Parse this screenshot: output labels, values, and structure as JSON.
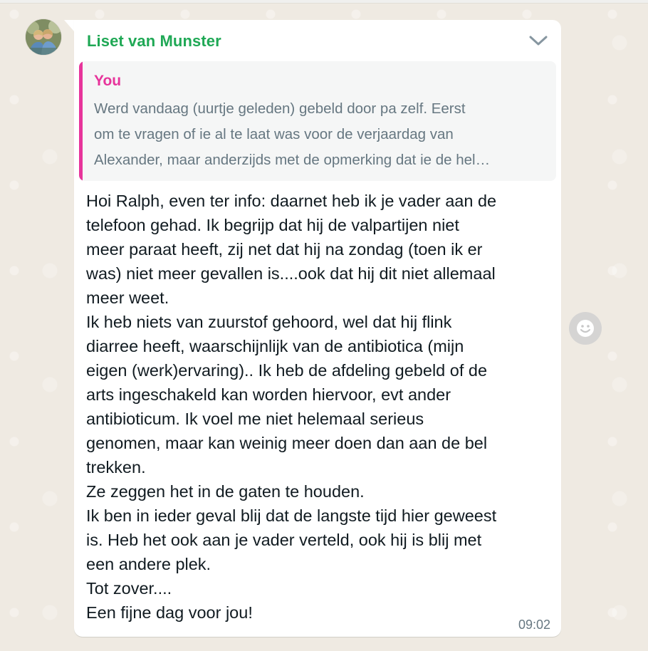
{
  "conversation": {
    "sender_name": "Liset van Munster",
    "avatar_icon": "profile-photo",
    "message_menu_icon": "chevron-down-icon",
    "quoted_message": {
      "author": "You",
      "text": "Werd vandaag (uurtje geleden) gebeld door pa zelf. Eerst\nom te vragen of ie al te laat was voor de verjaardag van\nAlexander, maar anderzijds met de opmerking dat ie de hel…"
    },
    "message_text": "Hoi Ralph, even ter info: daarnet heb ik je vader aan de\ntelefoon gehad. Ik begrijp dat hij de valpartijen niet\nmeer paraat heeft, zij net dat hij na zondag (toen ik er\nwas) niet meer gevallen is....ook dat hij dit niet allemaal\nmeer weet.\nIk heb niets van zuurstof gehoord, wel dat hij flink\ndiarree heeft, waarschijnlijk van de antibiotica (mijn\neigen (werk)ervaring).. Ik heb de afdeling gebeld of de\narts ingeschakeld kan worden hiervoor, evt ander\nantibioticum. Ik voel me niet helemaal serieus\ngenomen, maar kan weinig meer doen dan aan de bel\ntrekken.\nZe zeggen het in de gaten te houden.\nIk ben in ieder geval blij dat de langste tijd hier geweest\nis. Heb het ook aan je vader verteld, ook hij is blij met\neen andere plek.\nTot zover....\nEen fijne dag voor jou!",
    "time": "09:02",
    "reaction_icon": "smiley-icon"
  },
  "colors": {
    "chat_background": "#efeae2",
    "bubble": "#ffffff",
    "sender_name": "#1fa855",
    "quote_accent": "#e7349b",
    "quote_background": "#f5f6f6",
    "meta_text": "#667781",
    "message_text": "#111b21"
  }
}
